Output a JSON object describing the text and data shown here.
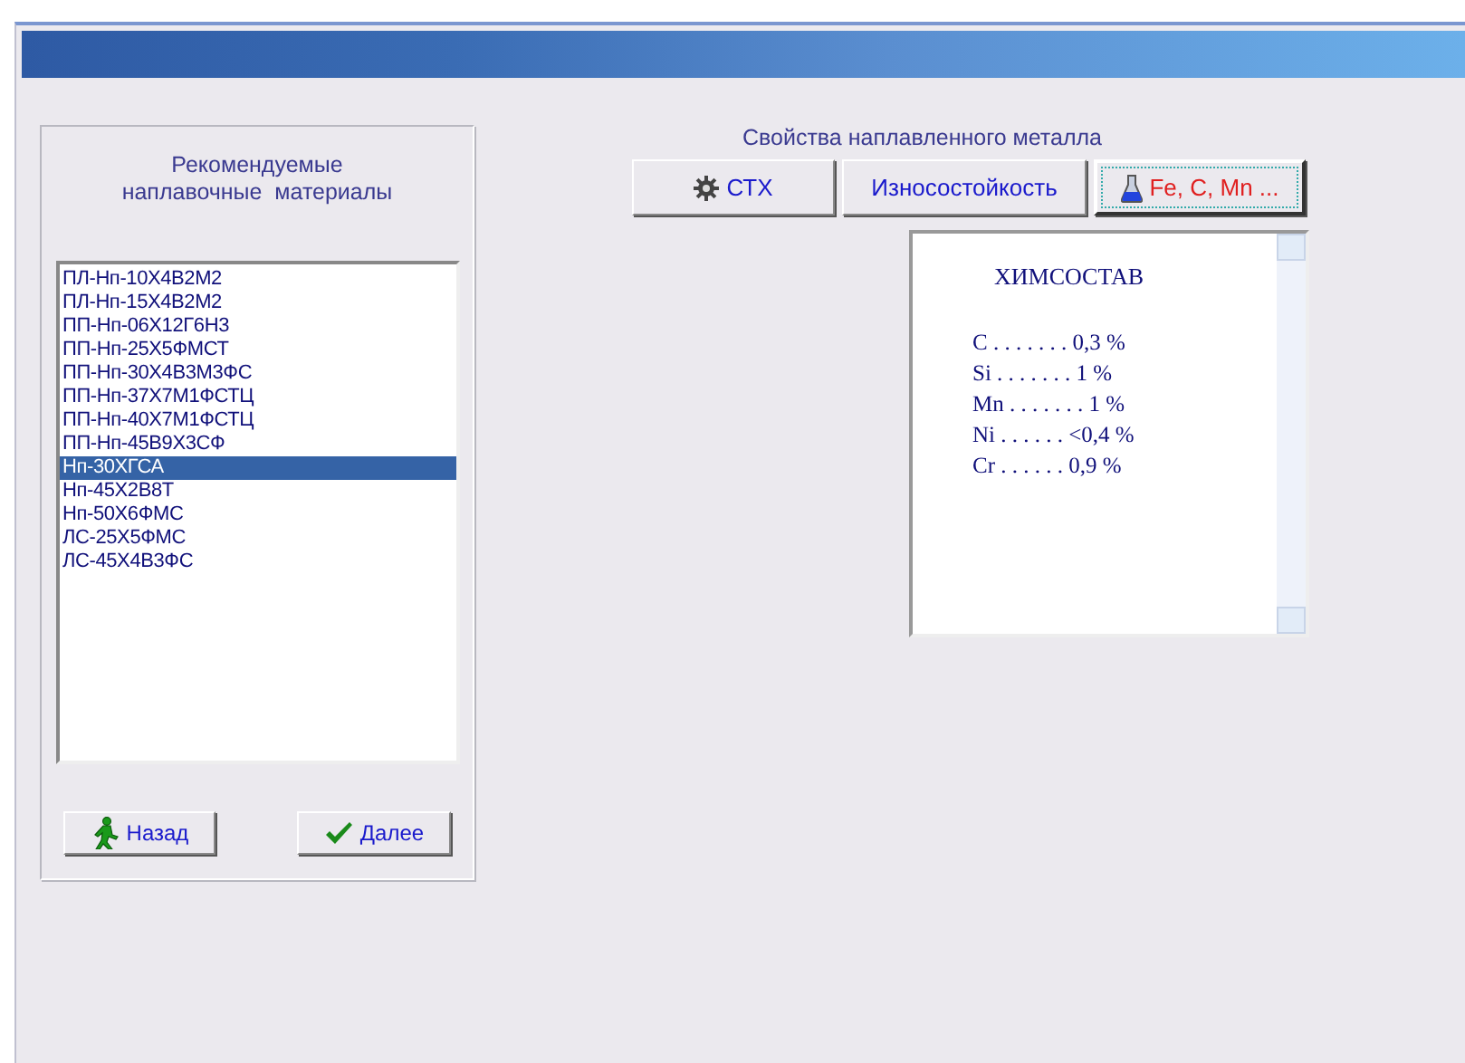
{
  "materials_panel": {
    "title": "Рекомендуемые\nнаплавочные  материалы",
    "items": [
      {
        "label": "ПЛ-Нп-10Х4В2М2",
        "selected": false
      },
      {
        "label": "ПЛ-Нп-15Х4В2М2",
        "selected": false
      },
      {
        "label": "ПП-Нп-06Х12Г6Н3",
        "selected": false
      },
      {
        "label": "ПП-Нп-25Х5ФМСТ",
        "selected": false
      },
      {
        "label": "ПП-Нп-30Х4В3М3ФС",
        "selected": false
      },
      {
        "label": "ПП-Нп-37Х7М1ФСТЦ",
        "selected": false
      },
      {
        "label": "ПП-Нп-40Х7М1ФСТЦ",
        "selected": false
      },
      {
        "label": "ПП-Нп-45В9Х3СФ",
        "selected": false
      },
      {
        "label": "Нп-30ХГСА",
        "selected": true
      },
      {
        "label": "Нп-45Х2В8Т",
        "selected": false
      },
      {
        "label": "Нп-50Х6ФМС",
        "selected": false
      },
      {
        "label": "ЛС-25Х5ФМС",
        "selected": false
      },
      {
        "label": "ЛС-45Х4В3ФС",
        "selected": false
      }
    ],
    "buttons": [
      {
        "label": "Назад",
        "kind": "back"
      },
      {
        "label": "Далее",
        "kind": "next"
      }
    ]
  },
  "properties": {
    "title": "Свойства наплавленного металла",
    "tabs": [
      {
        "label": "СТХ",
        "selected": false
      },
      {
        "label": "Износостойкость",
        "selected": false
      },
      {
        "label": "Fe, C, Mn ...",
        "selected": true
      }
    ],
    "content": {
      "heading": "ХИМСОСТАВ",
      "lines": [
        "C . . . . . . . 0,3 %",
        "Si . . . . . . . 1 %",
        "Mn . . . . . . . 1 %",
        "Ni . . . . . . <0,4 %",
        "Cr . . . . . . 0,9 %"
      ]
    }
  }
}
